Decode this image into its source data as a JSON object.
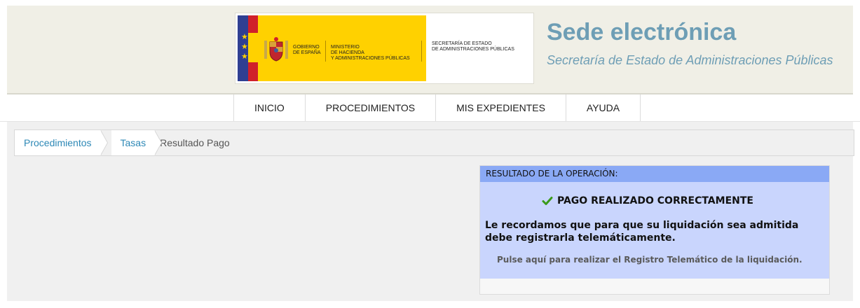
{
  "header": {
    "logo": {
      "gobierno": "GOBIERNO\nDE ESPAÑA",
      "ministerio": "MINISTERIO\nDE HACIENDA\nY ADMINISTRACIONES PÚBLICAS",
      "secretaria": "SECRETARÍA DE ESTADO\nDE ADMINISTRACIONES  PÚBLICAS"
    },
    "title": "Sede electrónica",
    "subtitle": "Secretaría de Estado de Administraciones Públicas"
  },
  "nav": {
    "items": [
      "INICIO",
      "PROCEDIMIENTOS",
      "MIS EXPEDIENTES",
      "AYUDA"
    ]
  },
  "breadcrumb": {
    "items": [
      "Procedimientos",
      "Tasas"
    ],
    "current": "Resultado Pago"
  },
  "result": {
    "header": "RESULTADO DE LA OPERACIÓN:",
    "status": "PAGO REALIZADO CORRECTAMENTE",
    "reminder": "Le recordamos que para que su liquidación sea admitida debe registrarla telemáticamente.",
    "link": "Pulse aquí para realizar el Registro Telemático de la liquidación.",
    "status_icon": "checkmark-icon",
    "colors": {
      "header_bg": "#8aa9f5",
      "body_bg": "#c9d5fd",
      "check": "#3a9a1a"
    }
  },
  "colors": {
    "title": "#6e9eb5",
    "link": "#2d88b6",
    "header_bg": "#f0efe6"
  }
}
